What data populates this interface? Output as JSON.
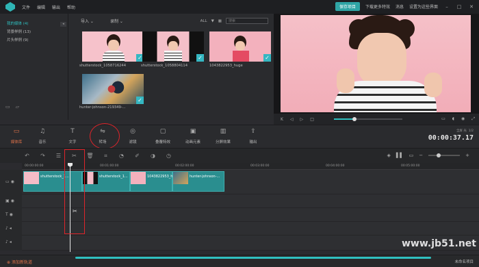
{
  "menu": [
    "文件",
    "编辑",
    "输出",
    "帮助"
  ],
  "titlebar": {
    "save_project": "保存项目",
    "download_effects": "下载更多特效",
    "messages": "消息",
    "set_default_layout": "设置为这些界面"
  },
  "library": {
    "sidebar": [
      {
        "label": "我的媒体 (4)",
        "active": true
      },
      {
        "label": "背景样例 (13)",
        "active": false
      },
      {
        "label": "片头样例 (9)",
        "active": false
      }
    ],
    "import_label": "导入",
    "record_label": "录制",
    "filter_all": "ALL",
    "search_placeholder": "搜索",
    "items": [
      {
        "name": "shutterstock_1058716244"
      },
      {
        "name": "shutterstock_1058804114"
      },
      {
        "name": "1043822953_huge"
      },
      {
        "name": "hunter-johnson-219349-..."
      }
    ]
  },
  "categories": [
    {
      "label": "媒体库",
      "icon": "folder-icon",
      "active": true
    },
    {
      "label": "音乐",
      "icon": "music-icon",
      "active": false
    },
    {
      "label": "文字",
      "icon": "text-icon",
      "active": false
    },
    {
      "label": "转场",
      "icon": "transition-icon",
      "active": false
    },
    {
      "label": "滤镜",
      "icon": "filter-icon",
      "active": false
    },
    {
      "label": "叠覆特效",
      "icon": "overlay-icon",
      "active": false
    },
    {
      "label": "动画元素",
      "icon": "elements-icon",
      "active": false
    },
    {
      "label": "分屏效果",
      "icon": "splitscreen-icon",
      "active": false
    },
    {
      "label": "输出",
      "icon": "export-icon",
      "active": false
    }
  ],
  "timecode": {
    "label_left": "全屏 光",
    "label_right": "1/2",
    "value": "00:00:37.17"
  },
  "ruler": [
    "00:00:00:00",
    "00:01:00:00",
    "00:02:00:00",
    "00:03:00:00",
    "00:04:00:00",
    "00:05:00:00"
  ],
  "clips": [
    {
      "name": "shutterstock_1..."
    },
    {
      "name": "shutterstock_1..."
    },
    {
      "name": "1043822953_h..."
    },
    {
      "name": "hunter-johnson-..."
    }
  ],
  "status": {
    "add_track": "添加新轨道",
    "project_name": "未命名项目"
  },
  "watermark": "www.jb51.net",
  "colors": {
    "accent": "#2fc0c0",
    "active_category": "#e2734a",
    "annotation": "#e0242a"
  }
}
